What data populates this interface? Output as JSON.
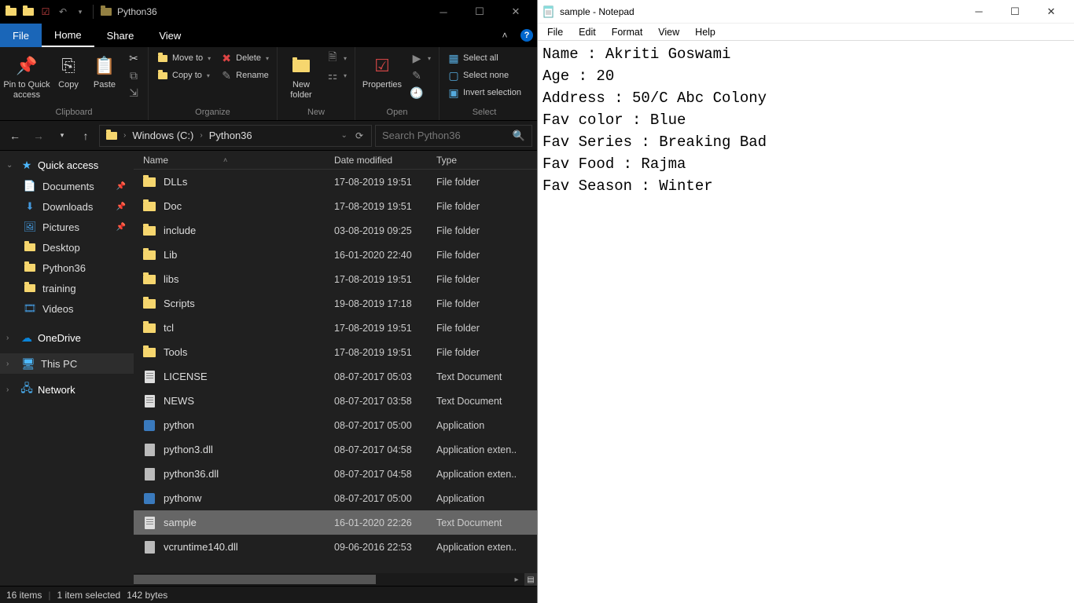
{
  "explorer": {
    "title": "Python36",
    "tabs": {
      "file": "File",
      "home": "Home",
      "share": "Share",
      "view": "View"
    },
    "ribbon": {
      "clipboard": {
        "label": "Clipboard",
        "pin": "Pin to Quick\naccess",
        "copy": "Copy",
        "paste": "Paste"
      },
      "organize": {
        "label": "Organize",
        "moveto": "Move to",
        "copyto": "Copy to",
        "delete": "Delete",
        "rename": "Rename"
      },
      "new": {
        "label": "New",
        "newfolder": "New\nfolder"
      },
      "open": {
        "label": "Open",
        "properties": "Properties"
      },
      "select": {
        "label": "Select",
        "selectall": "Select all",
        "selectnone": "Select none",
        "invert": "Invert selection"
      }
    },
    "address": {
      "seg1": "Windows (C:)",
      "seg2": "Python36"
    },
    "search_placeholder": "Search Python36",
    "sidebar": {
      "quickaccess": "Quick access",
      "qa_items": [
        {
          "label": "Documents",
          "icon": "doc"
        },
        {
          "label": "Downloads",
          "icon": "down"
        },
        {
          "label": "Pictures",
          "icon": "pic"
        },
        {
          "label": "Desktop",
          "icon": "folder"
        },
        {
          "label": "Python36",
          "icon": "folder"
        },
        {
          "label": "training",
          "icon": "folder"
        },
        {
          "label": "Videos",
          "icon": "vid"
        }
      ],
      "onedrive": "OneDrive",
      "thispc": "This PC",
      "network": "Network"
    },
    "columns": {
      "name": "Name",
      "date": "Date modified",
      "type": "Type"
    },
    "rows": [
      {
        "name": "DLLs",
        "date": "17-08-2019 19:51",
        "type": "File folder",
        "icon": "folder"
      },
      {
        "name": "Doc",
        "date": "17-08-2019 19:51",
        "type": "File folder",
        "icon": "folder"
      },
      {
        "name": "include",
        "date": "03-08-2019 09:25",
        "type": "File folder",
        "icon": "folder"
      },
      {
        "name": "Lib",
        "date": "16-01-2020 22:40",
        "type": "File folder",
        "icon": "folder"
      },
      {
        "name": "libs",
        "date": "17-08-2019 19:51",
        "type": "File folder",
        "icon": "folder"
      },
      {
        "name": "Scripts",
        "date": "19-08-2019 17:18",
        "type": "File folder",
        "icon": "folder"
      },
      {
        "name": "tcl",
        "date": "17-08-2019 19:51",
        "type": "File folder",
        "icon": "folder"
      },
      {
        "name": "Tools",
        "date": "17-08-2019 19:51",
        "type": "File folder",
        "icon": "folder"
      },
      {
        "name": "LICENSE",
        "date": "08-07-2017 05:03",
        "type": "Text Document",
        "icon": "text"
      },
      {
        "name": "NEWS",
        "date": "08-07-2017 03:58",
        "type": "Text Document",
        "icon": "text"
      },
      {
        "name": "python",
        "date": "08-07-2017 05:00",
        "type": "Application",
        "icon": "app"
      },
      {
        "name": "python3.dll",
        "date": "08-07-2017 04:58",
        "type": "Application exten..",
        "icon": "dll"
      },
      {
        "name": "python36.dll",
        "date": "08-07-2017 04:58",
        "type": "Application exten..",
        "icon": "dll"
      },
      {
        "name": "pythonw",
        "date": "08-07-2017 05:00",
        "type": "Application",
        "icon": "app"
      },
      {
        "name": "sample",
        "date": "16-01-2020 22:26",
        "type": "Text Document",
        "icon": "text",
        "selected": true
      },
      {
        "name": "vcruntime140.dll",
        "date": "09-06-2016 22:53",
        "type": "Application exten..",
        "icon": "dll"
      }
    ],
    "status": {
      "items": "16 items",
      "selected": "1 item selected",
      "size": "142 bytes"
    }
  },
  "notepad": {
    "title": "sample - Notepad",
    "menus": {
      "file": "File",
      "edit": "Edit",
      "format": "Format",
      "view": "View",
      "help": "Help"
    },
    "content": "Name : Akriti Goswami\nAge : 20\nAddress : 50/C Abc Colony\nFav color : Blue\nFav Series : Breaking Bad\nFav Food : Rajma\nFav Season : Winter"
  }
}
